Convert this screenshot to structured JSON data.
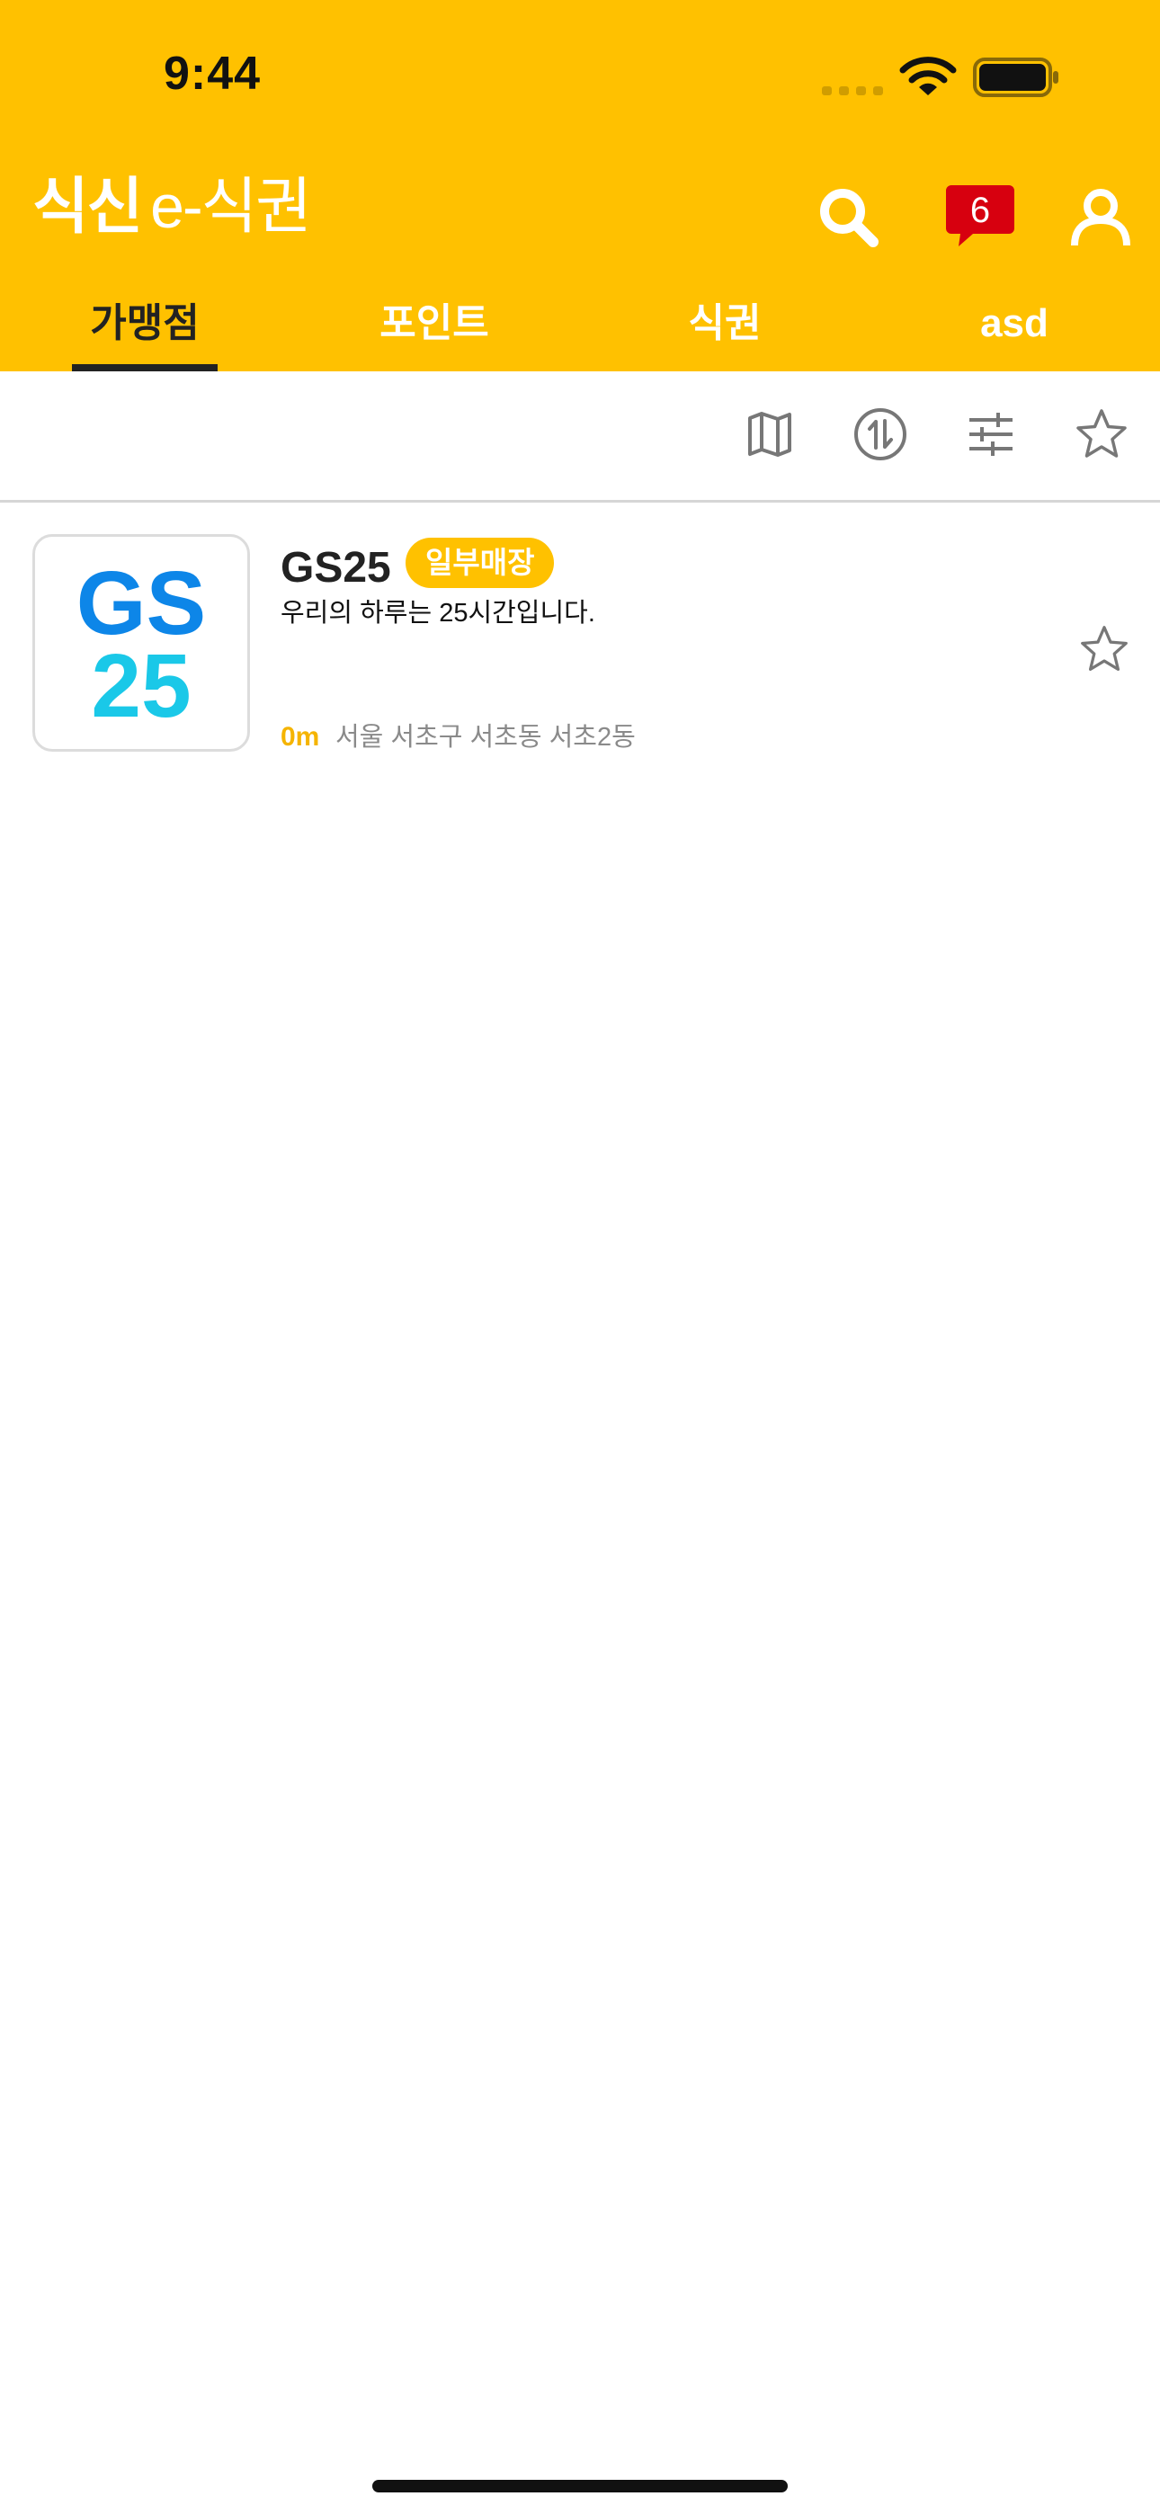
{
  "status_bar": {
    "time": "9:44"
  },
  "header": {
    "logo_main": "식신",
    "logo_sub": "e-식권",
    "notification_count": "6",
    "icons": [
      "search-icon",
      "chat-badge-icon",
      "profile-icon"
    ]
  },
  "tabs": [
    {
      "label": "가맹점",
      "active": true
    },
    {
      "label": "포인트",
      "active": false
    },
    {
      "label": "식권",
      "active": false
    },
    {
      "label": "asd",
      "active": false
    }
  ],
  "toolbar": {
    "icons": [
      "map-icon",
      "sort-icon",
      "filter-icon",
      "star-outline-icon"
    ]
  },
  "stores": [
    {
      "name": "GS25",
      "tag": "일부매장",
      "description": "우리의 하루는 25시간입니다.",
      "distance": "0m",
      "address": "서울 서초구 서초동 서초2동",
      "logo_text_top": "GS",
      "logo_text_bottom": "25"
    }
  ],
  "colors": {
    "brand": "#FFC100",
    "tab_active": "#222222",
    "badge": "#D7000F",
    "logo_blue": "#0D86E8",
    "logo_cyan": "#1AC8E8"
  }
}
